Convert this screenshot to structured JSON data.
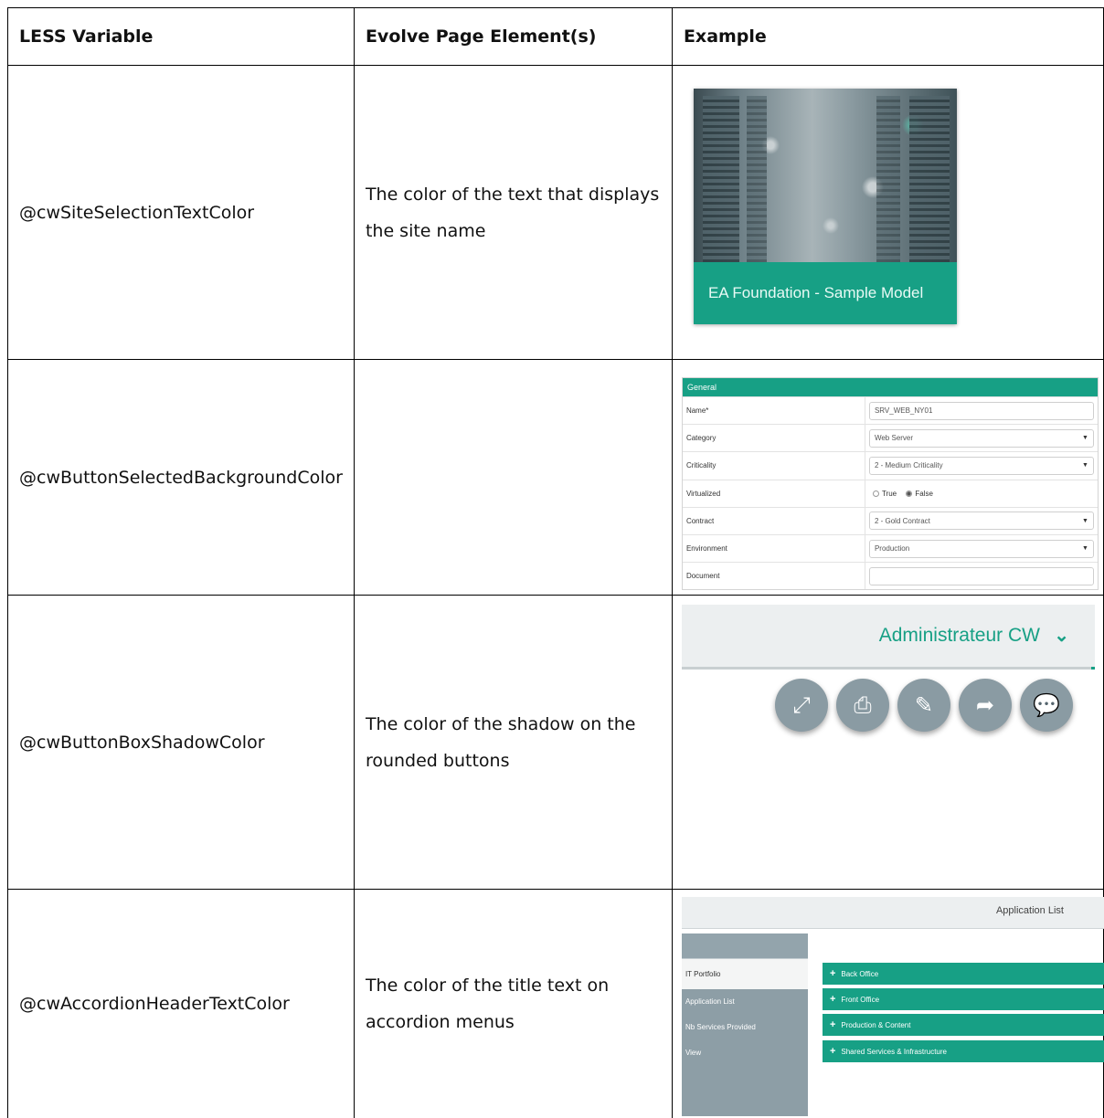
{
  "table": {
    "headers": [
      "LESS Variable",
      "Evolve Page Element(s)",
      "Example"
    ],
    "rows": [
      {
        "variable": "@cwSiteSelectionTextColor",
        "element": "The color of the text that displays the site name"
      },
      {
        "variable": "@cwButtonSelectedBackgroundColor",
        "element": ""
      },
      {
        "variable": "@cwButtonBoxShadowColor",
        "element": "The color of the shadow on the rounded buttons"
      },
      {
        "variable": "@cwAccordionHeaderTextColor",
        "element": "The color of the title text on accordion menus"
      }
    ]
  },
  "example1": {
    "site_name": "EA Foundation - Sample Model"
  },
  "example2": {
    "header": "General",
    "fields": [
      {
        "label": "Name*",
        "value": "SRV_WEB_NY01",
        "type": "text"
      },
      {
        "label": "Category",
        "value": "Web Server",
        "type": "select"
      },
      {
        "label": "Criticality",
        "value": "2 - Medium Criticality",
        "type": "select"
      },
      {
        "label": "Virtualized",
        "value": "",
        "type": "radio",
        "options": [
          "True",
          "False"
        ],
        "selected": "False"
      },
      {
        "label": "Contract",
        "value": "2 - Gold Contract",
        "type": "select"
      },
      {
        "label": "Environment",
        "value": "Production",
        "type": "select"
      },
      {
        "label": "Document",
        "value": "",
        "type": "text"
      }
    ]
  },
  "example3": {
    "user": "Administrateur CW",
    "buttons": [
      "expand-icon",
      "print-icon",
      "edit-icon",
      "share-icon",
      "comment-icon"
    ]
  },
  "example4": {
    "title": "Application List",
    "sidebar": [
      "IT Portfolio",
      "Application List",
      "Nb Services Provided",
      "View"
    ],
    "accordions": [
      "Back Office",
      "Front Office",
      "Production & Content",
      "Shared Services & Infrastructure"
    ]
  },
  "colors": {
    "accent": "#17a085",
    "button_gray": "#8a9ba3",
    "sidebar_gray": "#8d9ea6"
  }
}
